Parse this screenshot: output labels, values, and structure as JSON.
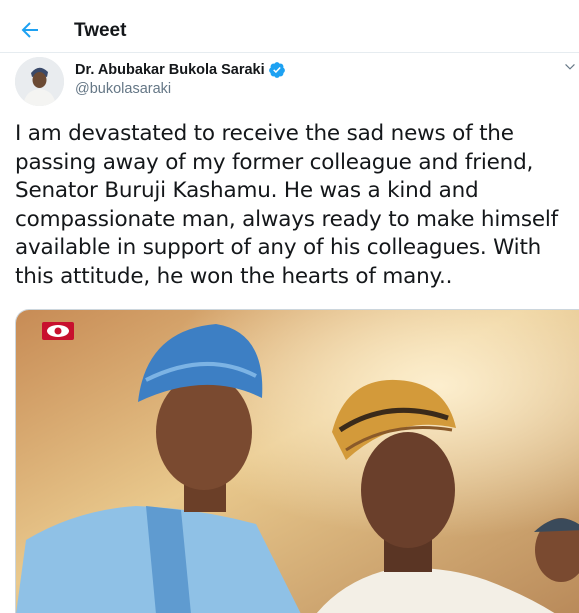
{
  "header": {
    "title": "Tweet",
    "back_icon": "arrow-left-icon"
  },
  "author": {
    "display_name": "Dr. Abubakar Bukola Saraki",
    "handle": "@bukolasaraki",
    "verified": true,
    "avatar_icon": "avatar"
  },
  "tweet": {
    "text": "I am devastated to receive the sad news of the passing away of my former colleague and friend, Senator Buruji Kashamu. He was a kind and compassionate man, always ready to make himself available in support of any of his colleagues. With this attitude, he won the hearts of many.."
  },
  "media": {
    "description_icon": "tweet-photo",
    "watermark_icon": "eye-logo-icon"
  },
  "colors": {
    "accent": "#1da1f2",
    "text": "#14171a",
    "secondary": "#657786",
    "border": "#e6ecf0"
  }
}
